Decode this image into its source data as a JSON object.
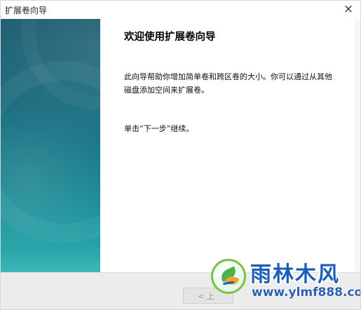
{
  "window": {
    "title": "扩展卷向导",
    "close_glyph": "×"
  },
  "content": {
    "heading": "欢迎使用扩展卷向导",
    "description": "此向导帮助你增加简单卷和跨区卷的大小。你可以通过从其他磁盘添加空间来扩展卷。",
    "next_hint": "单击“下一步”继续。"
  },
  "footer": {
    "back_label": "< 上"
  },
  "watermark": {
    "name": "雨林木风",
    "url": "www.ylmf888.com"
  },
  "colors": {
    "side_panel_top": "#1d5c70",
    "side_panel_bottom": "#3cb8b9",
    "watermark_blue": "#1b5fb8"
  },
  "icons": {
    "close": "close-icon",
    "logo": "ylmf-logo-icon"
  }
}
